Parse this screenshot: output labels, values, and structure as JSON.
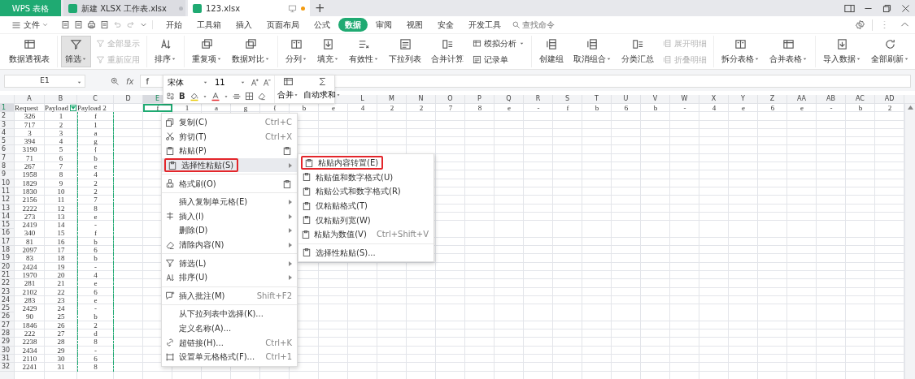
{
  "app_tab": {
    "label": "WPS 表格"
  },
  "doc_tabs": [
    {
      "label": "新建 XLSX 工作表.xlsx",
      "selected": false,
      "unsaved": false
    },
    {
      "label": "123.xlsx",
      "selected": true,
      "unsaved": true
    }
  ],
  "new_tab": {
    "label": "+"
  },
  "file_menu": {
    "label": "文件"
  },
  "ribbon_tabs": [
    {
      "label": "开始",
      "selected": false
    },
    {
      "label": "工具箱",
      "selected": false
    },
    {
      "label": "插入",
      "selected": false
    },
    {
      "label": "页面布局",
      "selected": false
    },
    {
      "label": "公式",
      "selected": false
    },
    {
      "label": "数据",
      "selected": true
    },
    {
      "label": "审阅",
      "selected": false
    },
    {
      "label": "视图",
      "selected": false
    },
    {
      "label": "安全",
      "selected": false
    },
    {
      "label": "开发工具",
      "selected": false
    }
  ],
  "command_search": {
    "placeholder": "查找命令"
  },
  "ribbon_groups": [
    {
      "items": [
        {
          "label": "数据透视表",
          "kind": "large",
          "dropdown": false,
          "disabled": false,
          "selected": false
        }
      ]
    },
    {
      "items": [
        {
          "label": "筛选",
          "kind": "large",
          "dropdown": true,
          "disabled": false,
          "selected": true
        },
        {
          "label": "全部显示",
          "kind": "small",
          "dropdown": false,
          "disabled": true,
          "selected": false
        },
        {
          "label": "重新应用",
          "kind": "small",
          "dropdown": false,
          "disabled": true,
          "selected": false
        }
      ]
    },
    {
      "items": [
        {
          "label": "排序",
          "kind": "large",
          "dropdown": true,
          "disabled": false,
          "selected": false
        }
      ]
    },
    {
      "items": [
        {
          "label": "重复项",
          "kind": "large",
          "dropdown": true,
          "disabled": false,
          "selected": false
        },
        {
          "label": "数据对比",
          "kind": "large",
          "dropdown": true,
          "disabled": false,
          "selected": false
        }
      ]
    },
    {
      "items": [
        {
          "label": "分列",
          "kind": "large",
          "dropdown": true,
          "disabled": false,
          "selected": false
        },
        {
          "label": "填充",
          "kind": "large",
          "dropdown": true,
          "disabled": false,
          "selected": false
        },
        {
          "label": "有效性",
          "kind": "large",
          "dropdown": true,
          "disabled": false,
          "selected": false
        },
        {
          "label": "下拉列表",
          "kind": "large",
          "dropdown": false,
          "disabled": false,
          "selected": false
        },
        {
          "label": "合并计算",
          "kind": "large",
          "dropdown": false,
          "disabled": false,
          "selected": false
        },
        {
          "label": "模拟分析",
          "kind": "small",
          "dropdown": true,
          "disabled": false,
          "selected": false
        },
        {
          "label": "记录单",
          "kind": "small",
          "dropdown": false,
          "disabled": false,
          "selected": false
        }
      ]
    },
    {
      "items": [
        {
          "label": "创建组",
          "kind": "large",
          "dropdown": false,
          "disabled": false,
          "selected": false
        },
        {
          "label": "取消组合",
          "kind": "large",
          "dropdown": true,
          "disabled": false,
          "selected": false
        },
        {
          "label": "分类汇总",
          "kind": "large",
          "dropdown": false,
          "disabled": false,
          "selected": false
        },
        {
          "label": "展开明细",
          "kind": "small",
          "dropdown": false,
          "disabled": true,
          "selected": false
        },
        {
          "label": "折叠明细",
          "kind": "small",
          "dropdown": false,
          "disabled": true,
          "selected": false
        }
      ]
    },
    {
      "items": [
        {
          "label": "拆分表格",
          "kind": "large",
          "dropdown": true,
          "disabled": false,
          "selected": false
        },
        {
          "label": "合并表格",
          "kind": "large",
          "dropdown": true,
          "disabled": false,
          "selected": false
        }
      ]
    },
    {
      "items": [
        {
          "label": "导入数据",
          "kind": "large",
          "dropdown": true,
          "disabled": false,
          "selected": false
        },
        {
          "label": "全部刷新",
          "kind": "large",
          "dropdown": true,
          "disabled": false,
          "selected": false
        }
      ]
    }
  ],
  "name_box": {
    "value": "E1"
  },
  "formula_bar": {
    "fx_label": "fx",
    "value": "f"
  },
  "mini_toolbar": {
    "font": "宋体",
    "size": "11",
    "bold": "B",
    "merge": "合并",
    "autosum": "自动求和"
  },
  "sheet": {
    "columns_left": [
      {
        "label": "A",
        "selected": false
      },
      {
        "label": "B",
        "selected": false
      },
      {
        "label": "C",
        "selected": false
      },
      {
        "label": "D",
        "selected": false
      },
      {
        "label": "E",
        "selected": true
      }
    ],
    "columns_right": [
      {
        "label": "L",
        "selected": false
      },
      {
        "label": "M",
        "selected": false
      },
      {
        "label": "N",
        "selected": false
      },
      {
        "label": "O",
        "selected": false
      },
      {
        "label": "P",
        "selected": false
      },
      {
        "label": "Q",
        "selected": false
      },
      {
        "label": "R",
        "selected": false
      },
      {
        "label": "S",
        "selected": false
      },
      {
        "label": "T",
        "selected": false
      },
      {
        "label": "U",
        "selected": false
      },
      {
        "label": "V",
        "selected": false
      },
      {
        "label": "W",
        "selected": false
      },
      {
        "label": "X",
        "selected": false
      },
      {
        "label": "Y",
        "selected": false
      },
      {
        "label": "Z",
        "selected": false
      },
      {
        "label": "AA",
        "selected": false
      },
      {
        "label": "AB",
        "selected": false
      },
      {
        "label": "AC",
        "selected": false
      },
      {
        "label": "AD",
        "selected": false
      }
    ],
    "rows": [
      {
        "number": "1",
        "selected": true,
        "cells": [
          "Request",
          {
            "text": "Payload",
            "filter": true
          },
          "Payload 2",
          null,
          "f",
          "1",
          "a",
          "g",
          "{",
          "b",
          "e",
          "4",
          "2",
          "2",
          "7",
          "8",
          "e",
          "-",
          "f",
          "b",
          "6",
          "b",
          "-",
          "4",
          "e",
          "6",
          "e",
          "-",
          "b",
          "2"
        ]
      },
      {
        "number": "2",
        "selected": false,
        "cells": [
          "326",
          "1",
          {
            "text": "f",
            "copied": true
          }
        ]
      },
      {
        "number": "3",
        "selected": false,
        "cells": [
          "717",
          "2",
          {
            "text": "1",
            "copied": true
          }
        ]
      },
      {
        "number": "4",
        "selected": false,
        "cells": [
          "3",
          "3",
          {
            "text": "a",
            "copied": true
          }
        ]
      },
      {
        "number": "5",
        "selected": false,
        "cells": [
          "394",
          "4",
          {
            "text": "g",
            "copied": true
          }
        ]
      },
      {
        "number": "6",
        "selected": false,
        "cells": [
          "3190",
          "5",
          {
            "text": "{",
            "copied": true
          }
        ]
      },
      {
        "number": "7",
        "selected": false,
        "cells": [
          "71",
          "6",
          {
            "text": "b",
            "copied": true
          }
        ]
      },
      {
        "number": "8",
        "selected": false,
        "cells": [
          "267",
          "7",
          {
            "text": "e",
            "copied": true
          }
        ]
      },
      {
        "number": "9",
        "selected": false,
        "cells": [
          "1958",
          "8",
          {
            "text": "4",
            "copied": true
          }
        ]
      },
      {
        "number": "10",
        "selected": false,
        "cells": [
          "1829",
          "9",
          {
            "text": "2",
            "copied": true
          }
        ]
      },
      {
        "number": "11",
        "selected": false,
        "cells": [
          "1830",
          "10",
          {
            "text": "2",
            "copied": true
          }
        ]
      },
      {
        "number": "12",
        "selected": false,
        "cells": [
          "2156",
          "11",
          {
            "text": "7",
            "copied": true
          }
        ]
      },
      {
        "number": "13",
        "selected": false,
        "cells": [
          "2222",
          "12",
          {
            "text": "8",
            "copied": true
          }
        ]
      },
      {
        "number": "14",
        "selected": false,
        "cells": [
          "273",
          "13",
          {
            "text": "e",
            "copied": true
          }
        ]
      },
      {
        "number": "15",
        "selected": false,
        "cells": [
          "2419",
          "14",
          {
            "text": "-",
            "copied": true
          }
        ]
      },
      {
        "number": "16",
        "selected": false,
        "cells": [
          "340",
          "15",
          {
            "text": "f",
            "copied": true
          }
        ]
      },
      {
        "number": "17",
        "selected": false,
        "cells": [
          "81",
          "16",
          {
            "text": "b",
            "copied": true
          }
        ]
      },
      {
        "number": "18",
        "selected": false,
        "cells": [
          "2097",
          "17",
          {
            "text": "6",
            "copied": true
          }
        ]
      },
      {
        "number": "19",
        "selected": false,
        "cells": [
          "83",
          "18",
          {
            "text": "b",
            "copied": true
          }
        ]
      },
      {
        "number": "20",
        "selected": false,
        "cells": [
          "2424",
          "19",
          {
            "text": "-",
            "copied": true
          }
        ]
      },
      {
        "number": "21",
        "selected": false,
        "cells": [
          "1970",
          "20",
          {
            "text": "4",
            "copied": true
          }
        ]
      },
      {
        "number": "22",
        "selected": false,
        "cells": [
          "281",
          "21",
          {
            "text": "e",
            "copied": true
          }
        ]
      },
      {
        "number": "23",
        "selected": false,
        "cells": [
          "2102",
          "22",
          {
            "text": "6",
            "copied": true
          }
        ]
      },
      {
        "number": "24",
        "selected": false,
        "cells": [
          "283",
          "23",
          {
            "text": "e",
            "copied": true
          }
        ]
      },
      {
        "number": "25",
        "selected": false,
        "cells": [
          "2429",
          "24",
          {
            "text": "-",
            "copied": true
          }
        ]
      },
      {
        "number": "26",
        "selected": false,
        "cells": [
          "90",
          "25",
          {
            "text": "b",
            "copied": true
          }
        ]
      },
      {
        "number": "27",
        "selected": false,
        "cells": [
          "1846",
          "26",
          {
            "text": "2",
            "copied": true
          }
        ]
      },
      {
        "number": "28",
        "selected": false,
        "cells": [
          "222",
          "27",
          {
            "text": "d",
            "copied": true
          }
        ]
      },
      {
        "number": "29",
        "selected": false,
        "cells": [
          "2238",
          "28",
          {
            "text": "8",
            "copied": true
          }
        ]
      },
      {
        "number": "30",
        "selected": false,
        "cells": [
          "2434",
          "29",
          {
            "text": "-",
            "copied": true
          }
        ]
      },
      {
        "number": "31",
        "selected": false,
        "cells": [
          "2110",
          "30",
          {
            "text": "6",
            "copied": true
          }
        ]
      },
      {
        "number": "32",
        "selected": false,
        "cells": [
          "2241",
          "31",
          {
            "text": "8",
            "copied": true
          }
        ]
      }
    ]
  },
  "context_menu": {
    "items": [
      {
        "kind": "item",
        "label": "复制(C)",
        "shortcut": "Ctrl+C",
        "submenu": false,
        "selected": false,
        "outlined": false
      },
      {
        "kind": "item",
        "label": "剪切(T)",
        "shortcut": "Ctrl+X",
        "submenu": false,
        "selected": false,
        "outlined": false
      },
      {
        "kind": "item",
        "label": "粘贴(P)",
        "submenu": false,
        "selected": false,
        "outlined": false,
        "trailing_icon": true
      },
      {
        "kind": "item",
        "label": "选择性粘贴(S)",
        "submenu": true,
        "selected": true,
        "outlined": true
      },
      {
        "kind": "separator"
      },
      {
        "kind": "item",
        "label": "格式刷(O)",
        "submenu": false,
        "selected": false,
        "outlined": false,
        "trailing_icon": true
      },
      {
        "kind": "separator"
      },
      {
        "kind": "item",
        "label": "插入复制单元格(E)",
        "submenu": true,
        "selected": false,
        "outlined": false
      },
      {
        "kind": "item",
        "label": "插入(I)",
        "submenu": true,
        "selected": false,
        "outlined": false
      },
      {
        "kind": "item",
        "label": "删除(D)",
        "submenu": true,
        "selected": false,
        "outlined": false
      },
      {
        "kind": "item",
        "label": "清除内容(N)",
        "submenu": true,
        "selected": false,
        "outlined": false
      },
      {
        "kind": "separator"
      },
      {
        "kind": "item",
        "label": "筛选(L)",
        "submenu": true,
        "selected": false,
        "outlined": false
      },
      {
        "kind": "item",
        "label": "排序(U)",
        "submenu": true,
        "selected": false,
        "outlined": false
      },
      {
        "kind": "separator"
      },
      {
        "kind": "item",
        "label": "插入批注(M)",
        "shortcut": "Shift+F2",
        "submenu": false,
        "selected": false,
        "outlined": false
      },
      {
        "kind": "separator"
      },
      {
        "kind": "item",
        "label": "从下拉列表中选择(K)...",
        "submenu": false,
        "selected": false,
        "outlined": false
      },
      {
        "kind": "item",
        "label": "定义名称(A)...",
        "submenu": false,
        "selected": false,
        "outlined": false
      },
      {
        "kind": "item",
        "label": "超链接(H)...",
        "shortcut": "Ctrl+K",
        "submenu": false,
        "selected": false,
        "outlined": false
      },
      {
        "kind": "item",
        "label": "设置单元格格式(F)...",
        "shortcut": "Ctrl+1",
        "submenu": false,
        "selected": false,
        "outlined": false
      }
    ]
  },
  "paste_special_menu": {
    "items": [
      {
        "kind": "item",
        "label": "粘贴内容转置(E)",
        "selected": false,
        "outlined": true
      },
      {
        "kind": "item",
        "label": "粘贴值和数字格式(U)",
        "selected": false,
        "outlined": false
      },
      {
        "kind": "item",
        "label": "粘贴公式和数字格式(R)",
        "selected": false,
        "outlined": false
      },
      {
        "kind": "item",
        "label": "仅粘贴格式(T)",
        "selected": false,
        "outlined": false
      },
      {
        "kind": "item",
        "label": "仅粘贴列宽(W)",
        "selected": false,
        "outlined": false
      },
      {
        "kind": "item",
        "label": "粘贴为数值(V)",
        "shortcut": "Ctrl+Shift+V",
        "selected": false,
        "outlined": false
      },
      {
        "kind": "separator"
      },
      {
        "kind": "item",
        "label": "选择性粘贴(S)...",
        "selected": false,
        "outlined": false
      }
    ]
  }
}
